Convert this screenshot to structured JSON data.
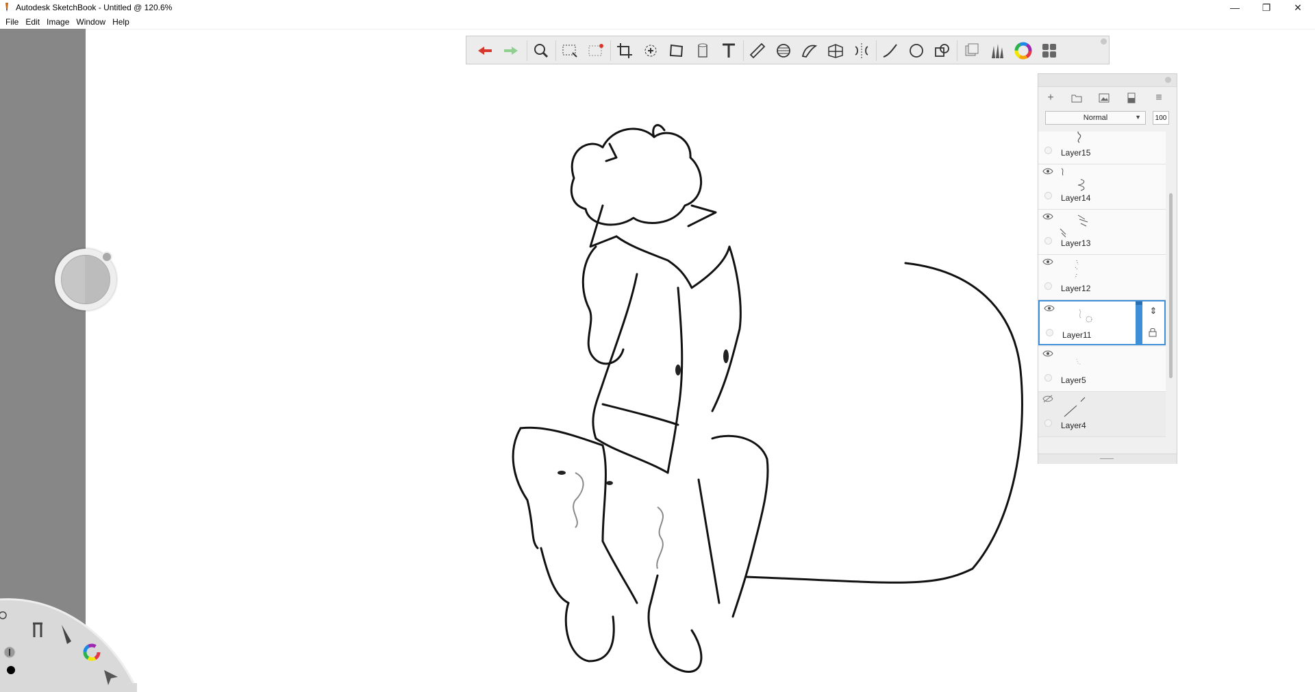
{
  "window": {
    "title": "Autodesk SketchBook - Untitled @ 120.6%",
    "controls": {
      "minimize": "—",
      "restore": "❐",
      "close": "✕"
    }
  },
  "menu": [
    "File",
    "Edit",
    "Image",
    "Window",
    "Help"
  ],
  "toolbar": {
    "tools": [
      "undo-icon",
      "redo-icon",
      "zoom-icon",
      "rect-select-icon",
      "select-clear-icon",
      "crop-icon",
      "transform-icon",
      "distort-icon",
      "fill-icon",
      "text-icon",
      "ruler-icon",
      "ellipse-guide-icon",
      "french-curve-icon",
      "perspective-icon",
      "symmetry-icon",
      "line-tool-icon",
      "circle-tool-icon",
      "shape-tool-icon",
      "copic-library-icon",
      "brush-library-icon",
      "color-wheel-icon",
      "layers-icon"
    ],
    "colors": {
      "undo": "#d9362b",
      "redo": "#8fd08f"
    }
  },
  "layers": {
    "blend_mode": "Normal",
    "opacity": "100",
    "items": [
      {
        "name": "Layer15",
        "visible": true,
        "selected": false
      },
      {
        "name": "Layer14",
        "visible": true,
        "selected": false
      },
      {
        "name": "Layer13",
        "visible": true,
        "selected": false
      },
      {
        "name": "Layer12",
        "visible": true,
        "selected": false
      },
      {
        "name": "Layer11",
        "visible": true,
        "selected": true
      },
      {
        "name": "Layer5",
        "visible": true,
        "selected": false
      },
      {
        "name": "Layer4",
        "visible": false,
        "selected": false
      }
    ],
    "accent": "#3f8fd8"
  },
  "lagoon": {
    "items": [
      "tools-icon",
      "brush-icon",
      "color-puck-icon",
      "brush-size-icon",
      "color-dot-icon",
      "cursor-icon"
    ]
  }
}
